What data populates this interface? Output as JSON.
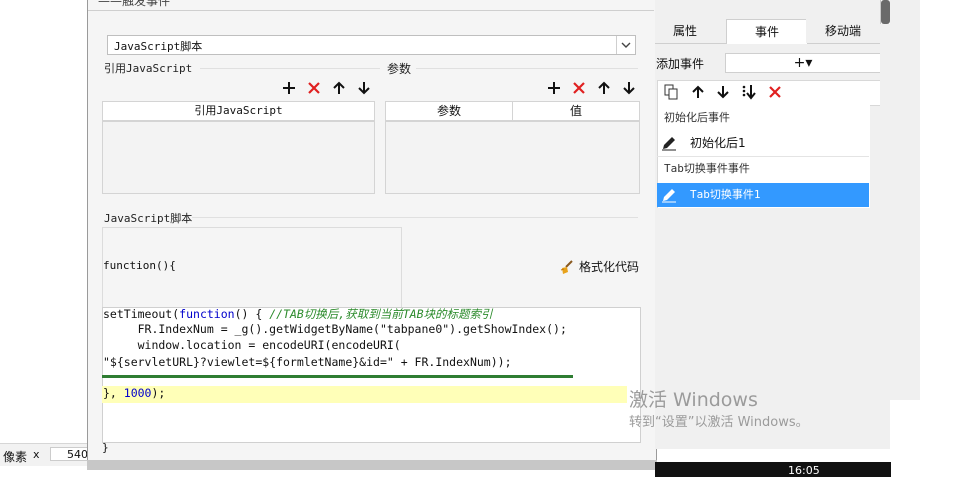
{
  "dialog": {
    "title_fragment": "——触发事件",
    "script_type": "JavaScript脚本",
    "ref_js_section": "引用JavaScript",
    "params_section": "参数",
    "ref_js_column": "引用JavaScript",
    "params_columns": [
      "参数",
      "值"
    ],
    "js_script_section": "JavaScript脚本",
    "function_open": "function(){",
    "format_code": "格式化代码",
    "function_close": "}",
    "code": {
      "line1_a": "setTimeout(",
      "line1_kw": "function",
      "line1_b": "() { ",
      "line1_comment": "//TAB切换后,获取到当前TAB块的标题索引",
      "line2": "     FR.IndexNum = _g().getWidgetByName(\"tabpane0\").getShowIndex();",
      "line3": "     window.location = encodeURI(encodeURI(",
      "line4": "\"${servletURL}?viewlet=${formletName}&id=\" + FR.IndexNum));",
      "line5_a": "}, ",
      "line5_num": "1000",
      "line5_b": ");"
    }
  },
  "left_status": {
    "label": "像素",
    "close": "x",
    "value": "540"
  },
  "right_panel": {
    "tabs": [
      "属性",
      "事件",
      "移动端"
    ],
    "add_event_label": "添加事件",
    "add_button": "+▾",
    "groups": [
      {
        "header": "初始化后事件",
        "item": "初始化后1"
      },
      {
        "header": "Tab切换事件事件",
        "item": "Tab切换事件1"
      }
    ]
  },
  "watermark": {
    "title": "激活 Windows",
    "subtitle": "转到“设置”以激活 Windows。"
  },
  "taskbar": {
    "time": "16:05"
  },
  "colors": {
    "accent": "#3399ff",
    "delete": "#e02020",
    "comment": "#2a8a2a",
    "keyword": "#0000cc",
    "highlight": "#ffffb8",
    "error_bar": "#2e7d32"
  }
}
